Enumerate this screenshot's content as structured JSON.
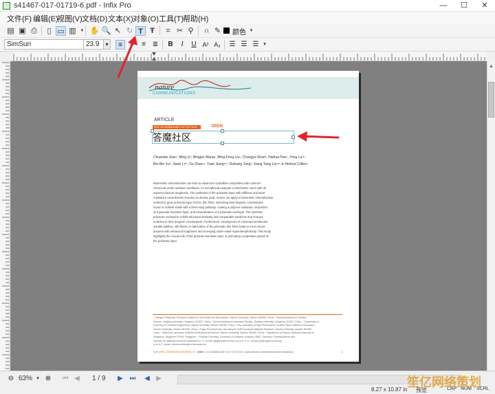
{
  "window": {
    "title": "s41467-017-01719-6.pdf - Infix Pro",
    "minimize": "—",
    "maximize": "☐",
    "close": "✕"
  },
  "menu": [
    "文件(F)",
    "编辑(E)",
    "视图(V)",
    "文档(D)",
    "文本(X)",
    "对象(O)",
    "工具(T)",
    "帮助(H)"
  ],
  "toolbar": {
    "color_label": "颜色"
  },
  "format_bar": {
    "font": "SimSun",
    "size": "23.9",
    "bold": "B",
    "italic": "I",
    "underline": "U",
    "superscript": "A²",
    "subscript": "A₂"
  },
  "document": {
    "journal_top": "nature",
    "journal_bottom": "COMMUNICATIONS",
    "article_label": "ARTICLE",
    "doi_bar": "DOI: 10.1038/s41467-017-01719-6",
    "open_label": "OPEN",
    "edited_title": "答魔社区",
    "authors_line1": "Chuanlan Xiao¹, Ming Li², Bingjun Wang¹, Ming-Feng Liu¹, Changyu Shao³, Haihua Pan⁴, Yong Lu¹²,",
    "authors_line2": "Bin-Bin Xu⁵, Siwei Li¹⁵, Da Zhan¹⁶, Yuan Jiang¹⁶⁷, Ruikang Tang³, Xiang Yang Liu¹⁶⁸ & Helmut Cölfen⁹",
    "abstract": [
      "Biomimetic mineralization can lead to advanced crystalline composites with common",
      "chemicals under ambient conditions. An exceptional example is biomimetic nacre with its",
      "superior fracture toughness. The synthesis of the prismatic layer with stiffness and wear",
      "resistance nevertheless remains an elusive goal. Herein, we apply a biomimetic mineralization",
      "method to grow prismatic-type CaCO₃ thin films, mimicking their biogenic counterparts",
      "found in mollusk shells with a three-step pathway: coating a polymer substrate, deposition",
      "of a granular transition layer, and mineralization of a prismatic overlayer. The synthetic",
      "prismatic overlayers exhibit structural similarity and comparable hardness and Young's",
      "modulus to their biogenic counterparts. Furthermore, employment of a biomacromolecular",
      "soluble additive, silk fibroin, in fabrication of the prismatic thin films leads to micro-/nano-",
      "textures with enhanced toughness and emerging under-water-superoleophobicity. This study",
      "highlights the crucial role of the granular transition layer in promoting competitive growth of",
      "the prismatic layer."
    ],
    "footnotes": [
      "¹ College of Materials, Research Institute for Soft Matter and Biomimetics, Xiamen University, Xiamen 361005, China. ² Crystal Academy for Interface",
      "Science, Zhejiang University, Hangzhou 310027, China. ³ Qiushi Academy for Advanced Studies, Zhejiang University, Hangzhou 310027, China. ⁴ Department of",
      "Chemistry & Chemical Engineering, Xiamen University, Xiamen 361005, China. ⁵ Key Laboratory of High Performance Ceramic Fibers, Ministry of Education,",
      "Xiamen University, Xiamen 361005, China. ⁶ Fujian Provincial Key Laboratory for Soft Functional Materials Research, Xiamen University, Xiamen 361005,",
      "China. ⁷ State Key Laboratory of Marine Environmental Science, Xiamen University, Xiamen 361005, China. ⁸ Department of Physics, National University of",
      "Singapore, Singapore 117542, Singapore. ⁹ Physical Chemistry, University of Konstanz, Konstanz 78457, Germany. Correspondence and",
      "requests for materials should be addressed to Y.J. (email: jiangyuan@xmu.edu.cn) or to X.Y.L. (email: phyliuxy@nus.edu.sg)",
      "or to H.C. (email: helmut.coelfen@uni-konstanz.de)"
    ],
    "footer_left": "NATURE COMMUNICATIONS | 8: 1398",
    "footer_mid": "| DOI: 10.1038/s41467-017-01719-6 | www.nature.com/naturecommunications",
    "footer_page": "1"
  },
  "status": {
    "zoom": "63%",
    "page": "1 / 9",
    "page_size": "8.27 x 10.87 in",
    "mode": "预览",
    "cap": "CAP",
    "num": "NUM",
    "scrl": "SCRL"
  },
  "watermark": "笙亿网络策划",
  "colors": {
    "annotation_arrow": "#e3232b",
    "doi_bar": "#e9631b",
    "selection_box": "#7db8c0"
  }
}
